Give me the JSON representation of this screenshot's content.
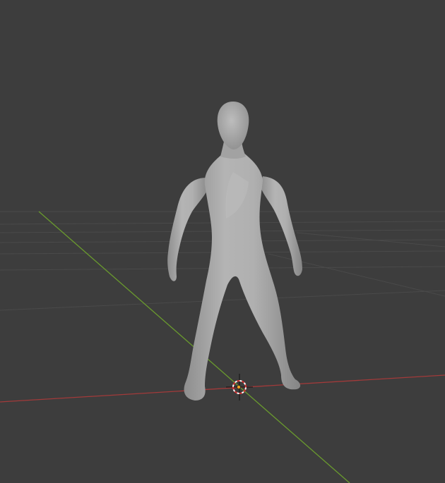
{
  "viewport": {
    "background": "#3d3d3d",
    "grid_color": "#4a4a4a",
    "x_axis_color": "#a23a3a",
    "y_axis_color": "#6a9a2e",
    "mesh_color": "#a8a8a8",
    "mesh_highlight": "#c6c6c6",
    "mesh_shadow": "#7e7e7e",
    "cursor_icon": "3d-cursor-icon",
    "origin_icon": "object-origin-icon"
  }
}
